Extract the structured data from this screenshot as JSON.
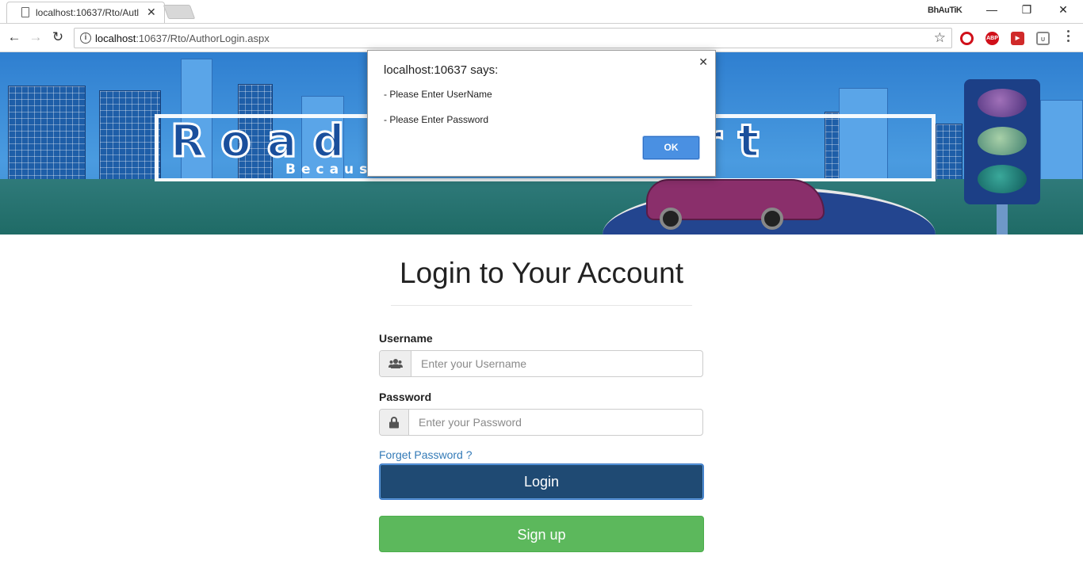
{
  "browser": {
    "tab_title": "localhost:10637/Rto/Autl",
    "profile_name": "BhAuTiK",
    "url_host": "localhost",
    "url_rest": ":10637/Rto/AuthorLogin.aspx"
  },
  "banner": {
    "logo_text": "Road   Transport",
    "tagline": "Because Moto"
  },
  "login": {
    "title": "Login to Your Account",
    "username_label": "Username",
    "username_placeholder": "Enter your Username",
    "password_label": "Password",
    "password_placeholder": "Enter your Password",
    "forget_link": "Forget Password ?",
    "login_button": "Login",
    "signup_button": "Sign up"
  },
  "alert": {
    "title": "localhost:10637 says:",
    "lines": [
      "- Please Enter UserName",
      "- Please Enter Password"
    ],
    "ok_label": "OK"
  },
  "colors": {
    "login_button": "#1f4a73",
    "signup_button": "#5cb85c",
    "link": "#337ab7",
    "dialog_ok": "#4a90e2"
  }
}
